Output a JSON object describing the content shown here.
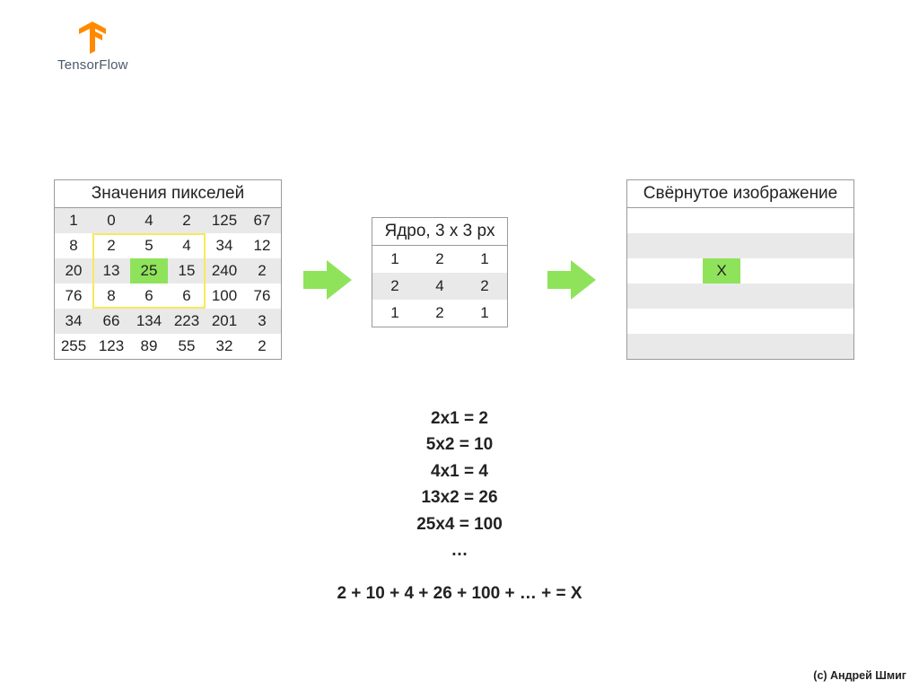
{
  "logo_text": "TensorFlow",
  "pixels": {
    "title": "Значения пикселей",
    "rows": [
      [
        1,
        0,
        4,
        2,
        125,
        67
      ],
      [
        8,
        2,
        5,
        4,
        34,
        12
      ],
      [
        20,
        13,
        25,
        15,
        240,
        2
      ],
      [
        76,
        8,
        6,
        6,
        100,
        76
      ],
      [
        34,
        66,
        134,
        223,
        201,
        3
      ],
      [
        255,
        123,
        89,
        55,
        32,
        2
      ]
    ],
    "highlight_cell": {
      "row": 2,
      "col": 2
    },
    "selection": {
      "row0": 1,
      "col0": 1,
      "rows": 3,
      "cols": 3
    }
  },
  "kernel": {
    "title": "Ядро, 3 x 3 px",
    "rows": [
      [
        1,
        2,
        1
      ],
      [
        2,
        4,
        2
      ],
      [
        1,
        2,
        1
      ]
    ]
  },
  "output": {
    "title": "Свёрнутое изображение",
    "rows": 6,
    "cols": 6,
    "highlight_cell": {
      "row": 2,
      "col": 2,
      "text": "X"
    }
  },
  "math": {
    "lines": [
      "2x1 = 2",
      "5x2 = 10",
      "4x1 = 4",
      "13x2 = 26",
      "25x4 = 100",
      "…"
    ],
    "sum": "2 + 10 + 4 + 26 + 100 + … + = X"
  },
  "credit": "(с) Андрей Шмиг"
}
